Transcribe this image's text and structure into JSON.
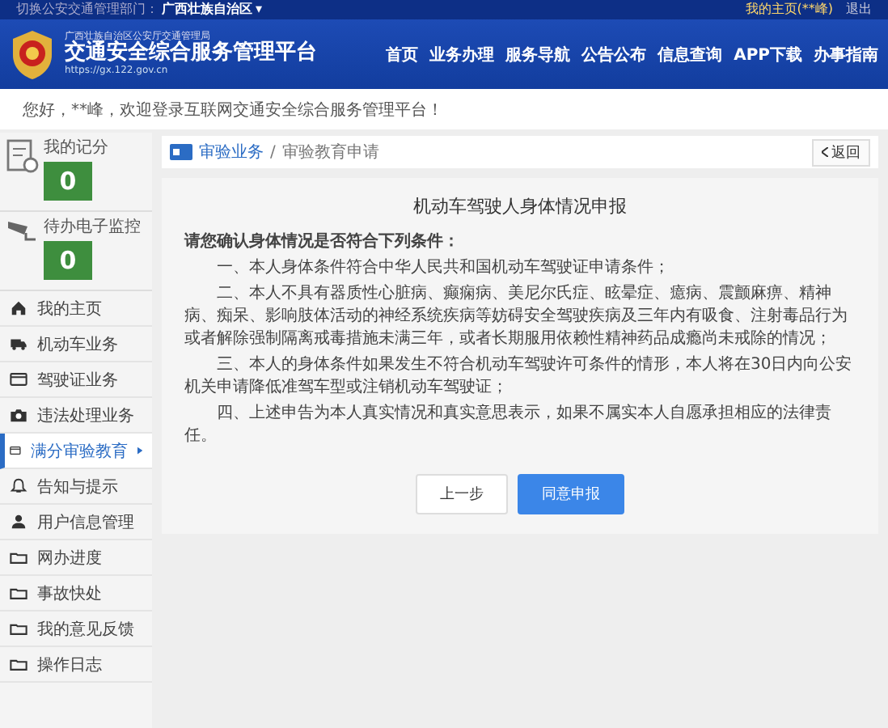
{
  "topbar": {
    "switch_label": "切换公安交通管理部门：",
    "region": "广西壮族自治区",
    "caret": "▾",
    "user_link": "我的主页(**峰)",
    "logout": "退出"
  },
  "header": {
    "agency": "广西壮族自治区公安厅交通管理局",
    "title": "交通安全综合服务管理平台",
    "url": "https://gx.122.gov.cn",
    "nav": [
      {
        "label": "首页"
      },
      {
        "label": "业务办理"
      },
      {
        "label": "服务导航"
      },
      {
        "label": "公告公布"
      },
      {
        "label": "信息查询"
      },
      {
        "label": "APP下载"
      },
      {
        "label": "办事指南"
      }
    ]
  },
  "welcome": "您好，**峰，欢迎登录互联网交通安全综合服务管理平台！",
  "sidebar": {
    "cards": [
      {
        "kind": "score",
        "label": "我的记分",
        "count": "0"
      },
      {
        "kind": "camera",
        "label": "待办电子监控",
        "count": "0"
      }
    ],
    "items": [
      {
        "kind": "home",
        "label": "我的主页",
        "selected": false
      },
      {
        "kind": "truck",
        "label": "机动车业务",
        "selected": false
      },
      {
        "kind": "card",
        "label": "驾驶证业务",
        "selected": false
      },
      {
        "kind": "camera",
        "label": "违法处理业务",
        "selected": false
      },
      {
        "kind": "card",
        "label": "满分审验教育",
        "selected": true
      },
      {
        "kind": "bell",
        "label": "告知与提示",
        "selected": false
      },
      {
        "kind": "user",
        "label": "用户信息管理",
        "selected": false
      },
      {
        "kind": "folder",
        "label": "网办进度",
        "selected": false
      },
      {
        "kind": "folder",
        "label": "事故快处",
        "selected": false
      },
      {
        "kind": "folder",
        "label": "我的意见反馈",
        "selected": false
      },
      {
        "kind": "folder",
        "label": "操作日志",
        "selected": false
      }
    ]
  },
  "breadcrumb": {
    "section": "审验业务",
    "separator": "/",
    "page": "审验教育申请",
    "back": "返回"
  },
  "form": {
    "title": "机动车驾驶人身体情况申报",
    "intro": "请您确认身体情况是否符合下列条件：",
    "conditions": [
      "一、本人身体条件符合中华人民共和国机动车驾驶证申请条件；",
      "二、本人不具有器质性心脏病、癫痫病、美尼尔氏症、眩晕症、癔病、震颤麻痹、精神病、痴呆、影响肢体活动的神经系统疾病等妨碍安全驾驶疾病及三年内有吸食、注射毒品行为或者解除强制隔离戒毒措施未满三年，或者长期服用依赖性精神药品成瘾尚未戒除的情况；",
      "三、本人的身体条件如果发生不符合机动车驾驶许可条件的情形，本人将在30日内向公安机关申请降低准驾车型或注销机动车驾驶证；",
      "四、上述申告为本人真实情况和真实意思表示，如果不属实本人自愿承担相应的法律责任。"
    ],
    "buttons": [
      {
        "kind": "secondary",
        "label": "上一步"
      },
      {
        "kind": "primary",
        "label": "同意申报"
      }
    ]
  }
}
